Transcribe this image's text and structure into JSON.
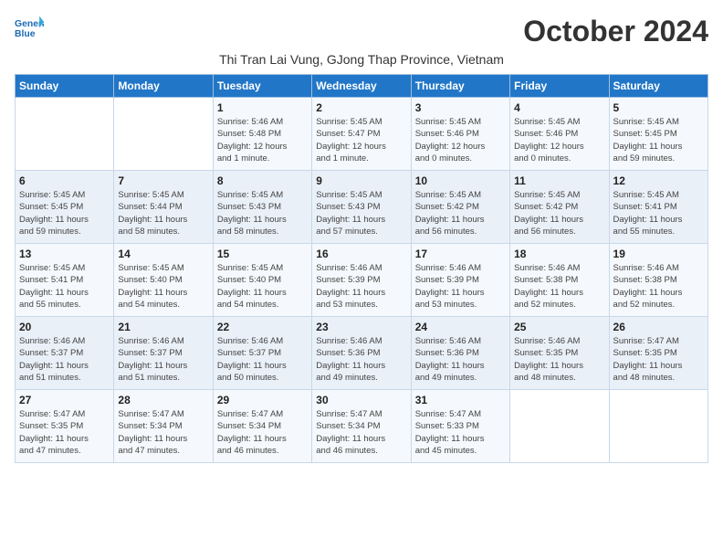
{
  "logo": {
    "line1": "General",
    "line2": "Blue"
  },
  "title": "October 2024",
  "subtitle": "Thi Tran Lai Vung, GJong Thap Province, Vietnam",
  "weekdays": [
    "Sunday",
    "Monday",
    "Tuesday",
    "Wednesday",
    "Thursday",
    "Friday",
    "Saturday"
  ],
  "weeks": [
    [
      {
        "num": "",
        "detail": ""
      },
      {
        "num": "",
        "detail": ""
      },
      {
        "num": "1",
        "detail": "Sunrise: 5:46 AM\nSunset: 5:48 PM\nDaylight: 12 hours\nand 1 minute."
      },
      {
        "num": "2",
        "detail": "Sunrise: 5:45 AM\nSunset: 5:47 PM\nDaylight: 12 hours\nand 1 minute."
      },
      {
        "num": "3",
        "detail": "Sunrise: 5:45 AM\nSunset: 5:46 PM\nDaylight: 12 hours\nand 0 minutes."
      },
      {
        "num": "4",
        "detail": "Sunrise: 5:45 AM\nSunset: 5:46 PM\nDaylight: 12 hours\nand 0 minutes."
      },
      {
        "num": "5",
        "detail": "Sunrise: 5:45 AM\nSunset: 5:45 PM\nDaylight: 11 hours\nand 59 minutes."
      }
    ],
    [
      {
        "num": "6",
        "detail": "Sunrise: 5:45 AM\nSunset: 5:45 PM\nDaylight: 11 hours\nand 59 minutes."
      },
      {
        "num": "7",
        "detail": "Sunrise: 5:45 AM\nSunset: 5:44 PM\nDaylight: 11 hours\nand 58 minutes."
      },
      {
        "num": "8",
        "detail": "Sunrise: 5:45 AM\nSunset: 5:43 PM\nDaylight: 11 hours\nand 58 minutes."
      },
      {
        "num": "9",
        "detail": "Sunrise: 5:45 AM\nSunset: 5:43 PM\nDaylight: 11 hours\nand 57 minutes."
      },
      {
        "num": "10",
        "detail": "Sunrise: 5:45 AM\nSunset: 5:42 PM\nDaylight: 11 hours\nand 56 minutes."
      },
      {
        "num": "11",
        "detail": "Sunrise: 5:45 AM\nSunset: 5:42 PM\nDaylight: 11 hours\nand 56 minutes."
      },
      {
        "num": "12",
        "detail": "Sunrise: 5:45 AM\nSunset: 5:41 PM\nDaylight: 11 hours\nand 55 minutes."
      }
    ],
    [
      {
        "num": "13",
        "detail": "Sunrise: 5:45 AM\nSunset: 5:41 PM\nDaylight: 11 hours\nand 55 minutes."
      },
      {
        "num": "14",
        "detail": "Sunrise: 5:45 AM\nSunset: 5:40 PM\nDaylight: 11 hours\nand 54 minutes."
      },
      {
        "num": "15",
        "detail": "Sunrise: 5:45 AM\nSunset: 5:40 PM\nDaylight: 11 hours\nand 54 minutes."
      },
      {
        "num": "16",
        "detail": "Sunrise: 5:46 AM\nSunset: 5:39 PM\nDaylight: 11 hours\nand 53 minutes."
      },
      {
        "num": "17",
        "detail": "Sunrise: 5:46 AM\nSunset: 5:39 PM\nDaylight: 11 hours\nand 53 minutes."
      },
      {
        "num": "18",
        "detail": "Sunrise: 5:46 AM\nSunset: 5:38 PM\nDaylight: 11 hours\nand 52 minutes."
      },
      {
        "num": "19",
        "detail": "Sunrise: 5:46 AM\nSunset: 5:38 PM\nDaylight: 11 hours\nand 52 minutes."
      }
    ],
    [
      {
        "num": "20",
        "detail": "Sunrise: 5:46 AM\nSunset: 5:37 PM\nDaylight: 11 hours\nand 51 minutes."
      },
      {
        "num": "21",
        "detail": "Sunrise: 5:46 AM\nSunset: 5:37 PM\nDaylight: 11 hours\nand 51 minutes."
      },
      {
        "num": "22",
        "detail": "Sunrise: 5:46 AM\nSunset: 5:37 PM\nDaylight: 11 hours\nand 50 minutes."
      },
      {
        "num": "23",
        "detail": "Sunrise: 5:46 AM\nSunset: 5:36 PM\nDaylight: 11 hours\nand 49 minutes."
      },
      {
        "num": "24",
        "detail": "Sunrise: 5:46 AM\nSunset: 5:36 PM\nDaylight: 11 hours\nand 49 minutes."
      },
      {
        "num": "25",
        "detail": "Sunrise: 5:46 AM\nSunset: 5:35 PM\nDaylight: 11 hours\nand 48 minutes."
      },
      {
        "num": "26",
        "detail": "Sunrise: 5:47 AM\nSunset: 5:35 PM\nDaylight: 11 hours\nand 48 minutes."
      }
    ],
    [
      {
        "num": "27",
        "detail": "Sunrise: 5:47 AM\nSunset: 5:35 PM\nDaylight: 11 hours\nand 47 minutes."
      },
      {
        "num": "28",
        "detail": "Sunrise: 5:47 AM\nSunset: 5:34 PM\nDaylight: 11 hours\nand 47 minutes."
      },
      {
        "num": "29",
        "detail": "Sunrise: 5:47 AM\nSunset: 5:34 PM\nDaylight: 11 hours\nand 46 minutes."
      },
      {
        "num": "30",
        "detail": "Sunrise: 5:47 AM\nSunset: 5:34 PM\nDaylight: 11 hours\nand 46 minutes."
      },
      {
        "num": "31",
        "detail": "Sunrise: 5:47 AM\nSunset: 5:33 PM\nDaylight: 11 hours\nand 45 minutes."
      },
      {
        "num": "",
        "detail": ""
      },
      {
        "num": "",
        "detail": ""
      }
    ]
  ]
}
